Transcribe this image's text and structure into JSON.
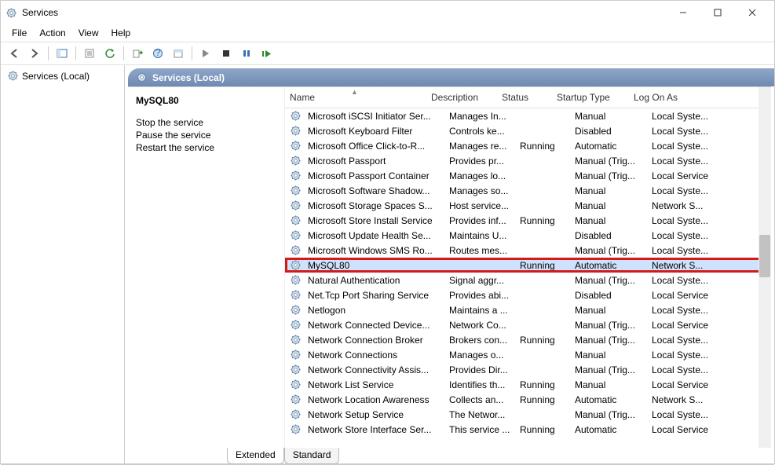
{
  "window": {
    "title": "Services"
  },
  "menu": {
    "file": "File",
    "action": "Action",
    "view": "View",
    "help": "Help"
  },
  "left": {
    "root": "Services (Local)"
  },
  "right_header": {
    "title": "Services (Local)"
  },
  "detail": {
    "selected_name": "MySQL80",
    "stop_link": "Stop",
    "stop_rest": " the service",
    "pause_link": "Pause",
    "pause_rest": " the service",
    "restart_link": "Restart",
    "restart_rest": " the service"
  },
  "columns": {
    "name": "Name",
    "description": "Description",
    "status": "Status",
    "startup": "Startup Type",
    "logon": "Log On As"
  },
  "tabs": {
    "extended": "Extended",
    "standard": "Standard"
  },
  "services": [
    {
      "name": "Microsoft iSCSI Initiator Ser...",
      "desc": "Manages In...",
      "status": "",
      "type": "Manual",
      "logon": "Local Syste..."
    },
    {
      "name": "Microsoft Keyboard Filter",
      "desc": "Controls ke...",
      "status": "",
      "type": "Disabled",
      "logon": "Local Syste..."
    },
    {
      "name": "Microsoft Office Click-to-R...",
      "desc": "Manages re...",
      "status": "Running",
      "type": "Automatic",
      "logon": "Local Syste..."
    },
    {
      "name": "Microsoft Passport",
      "desc": "Provides pr...",
      "status": "",
      "type": "Manual (Trig...",
      "logon": "Local Syste..."
    },
    {
      "name": "Microsoft Passport Container",
      "desc": "Manages lo...",
      "status": "",
      "type": "Manual (Trig...",
      "logon": "Local Service"
    },
    {
      "name": "Microsoft Software Shadow...",
      "desc": "Manages so...",
      "status": "",
      "type": "Manual",
      "logon": "Local Syste..."
    },
    {
      "name": "Microsoft Storage Spaces S...",
      "desc": "Host service...",
      "status": "",
      "type": "Manual",
      "logon": "Network S..."
    },
    {
      "name": "Microsoft Store Install Service",
      "desc": "Provides inf...",
      "status": "Running",
      "type": "Manual",
      "logon": "Local Syste..."
    },
    {
      "name": "Microsoft Update Health Se...",
      "desc": "Maintains U...",
      "status": "",
      "type": "Disabled",
      "logon": "Local Syste..."
    },
    {
      "name": "Microsoft Windows SMS Ro...",
      "desc": "Routes mes...",
      "status": "",
      "type": "Manual (Trig...",
      "logon": "Local Syste..."
    },
    {
      "name": "MySQL80",
      "desc": "",
      "status": "Running",
      "type": "Automatic",
      "logon": "Network S...",
      "selected": true,
      "highlight": true
    },
    {
      "name": "Natural Authentication",
      "desc": "Signal aggr...",
      "status": "",
      "type": "Manual (Trig...",
      "logon": "Local Syste..."
    },
    {
      "name": "Net.Tcp Port Sharing Service",
      "desc": "Provides abi...",
      "status": "",
      "type": "Disabled",
      "logon": "Local Service"
    },
    {
      "name": "Netlogon",
      "desc": "Maintains a ...",
      "status": "",
      "type": "Manual",
      "logon": "Local Syste..."
    },
    {
      "name": "Network Connected Device...",
      "desc": "Network Co...",
      "status": "",
      "type": "Manual (Trig...",
      "logon": "Local Service"
    },
    {
      "name": "Network Connection Broker",
      "desc": "Brokers con...",
      "status": "Running",
      "type": "Manual (Trig...",
      "logon": "Local Syste..."
    },
    {
      "name": "Network Connections",
      "desc": "Manages o...",
      "status": "",
      "type": "Manual",
      "logon": "Local Syste..."
    },
    {
      "name": "Network Connectivity Assis...",
      "desc": "Provides Dir...",
      "status": "",
      "type": "Manual (Trig...",
      "logon": "Local Syste..."
    },
    {
      "name": "Network List Service",
      "desc": "Identifies th...",
      "status": "Running",
      "type": "Manual",
      "logon": "Local Service"
    },
    {
      "name": "Network Location Awareness",
      "desc": "Collects an...",
      "status": "Running",
      "type": "Automatic",
      "logon": "Network S..."
    },
    {
      "name": "Network Setup Service",
      "desc": "The Networ...",
      "status": "",
      "type": "Manual (Trig...",
      "logon": "Local Syste..."
    },
    {
      "name": "Network Store Interface Ser...",
      "desc": "This service ...",
      "status": "Running",
      "type": "Automatic",
      "logon": "Local Service"
    }
  ]
}
